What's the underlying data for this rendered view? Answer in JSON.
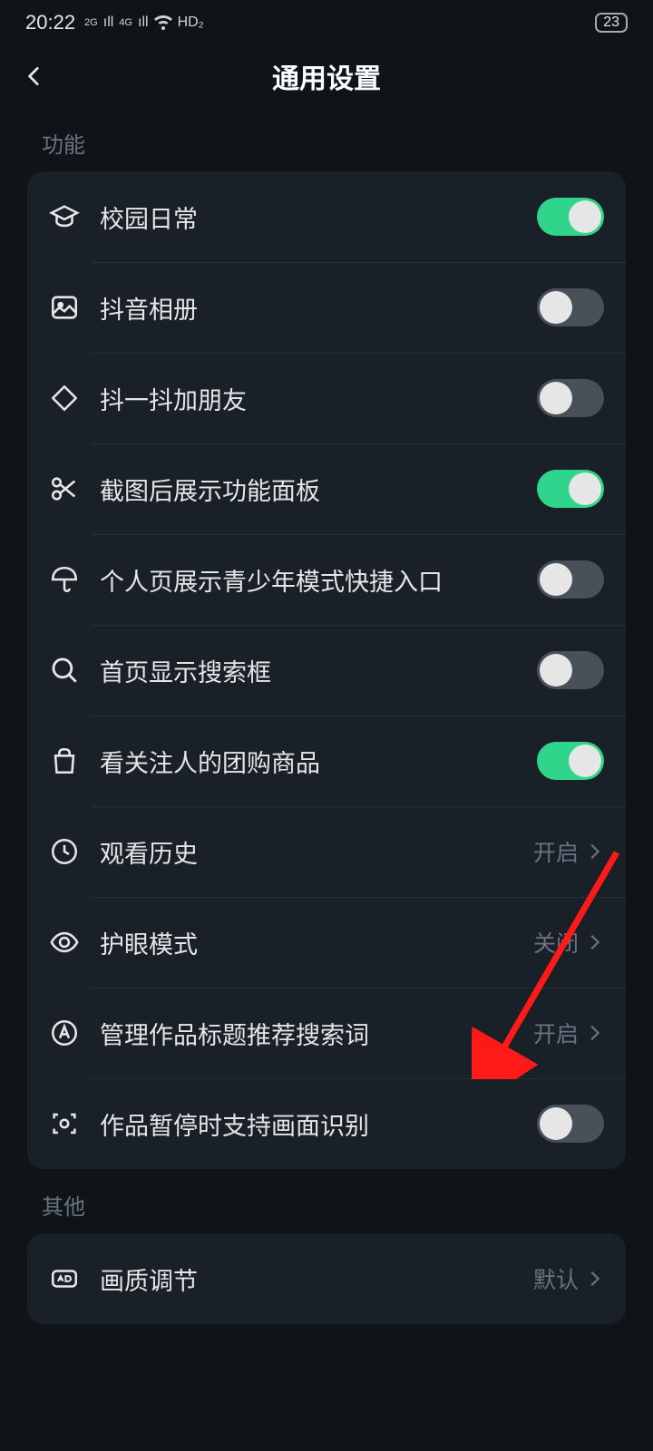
{
  "status": {
    "time": "20:22",
    "signal": "2G 4G",
    "hd": "HD₂",
    "battery": "23"
  },
  "header": {
    "title": "通用设置"
  },
  "sections": {
    "func_label": "功能",
    "other_label": "其他"
  },
  "items": {
    "campus": "校园日常",
    "album": "抖音相册",
    "shake": "抖一抖加朋友",
    "screenshot": "截图后展示功能面板",
    "teen": "个人页展示青少年模式快捷入口",
    "search": "首页显示搜索框",
    "groupbuy": "看关注人的团购商品",
    "history": "观看历史",
    "history_val": "开启",
    "eye": "护眼模式",
    "eye_val": "关闭",
    "keywords": "管理作品标题推荐搜索词",
    "keywords_val": "开启",
    "pauseocr": "作品暂停时支持画面识别",
    "quality": "画质调节",
    "quality_val": "默认"
  }
}
